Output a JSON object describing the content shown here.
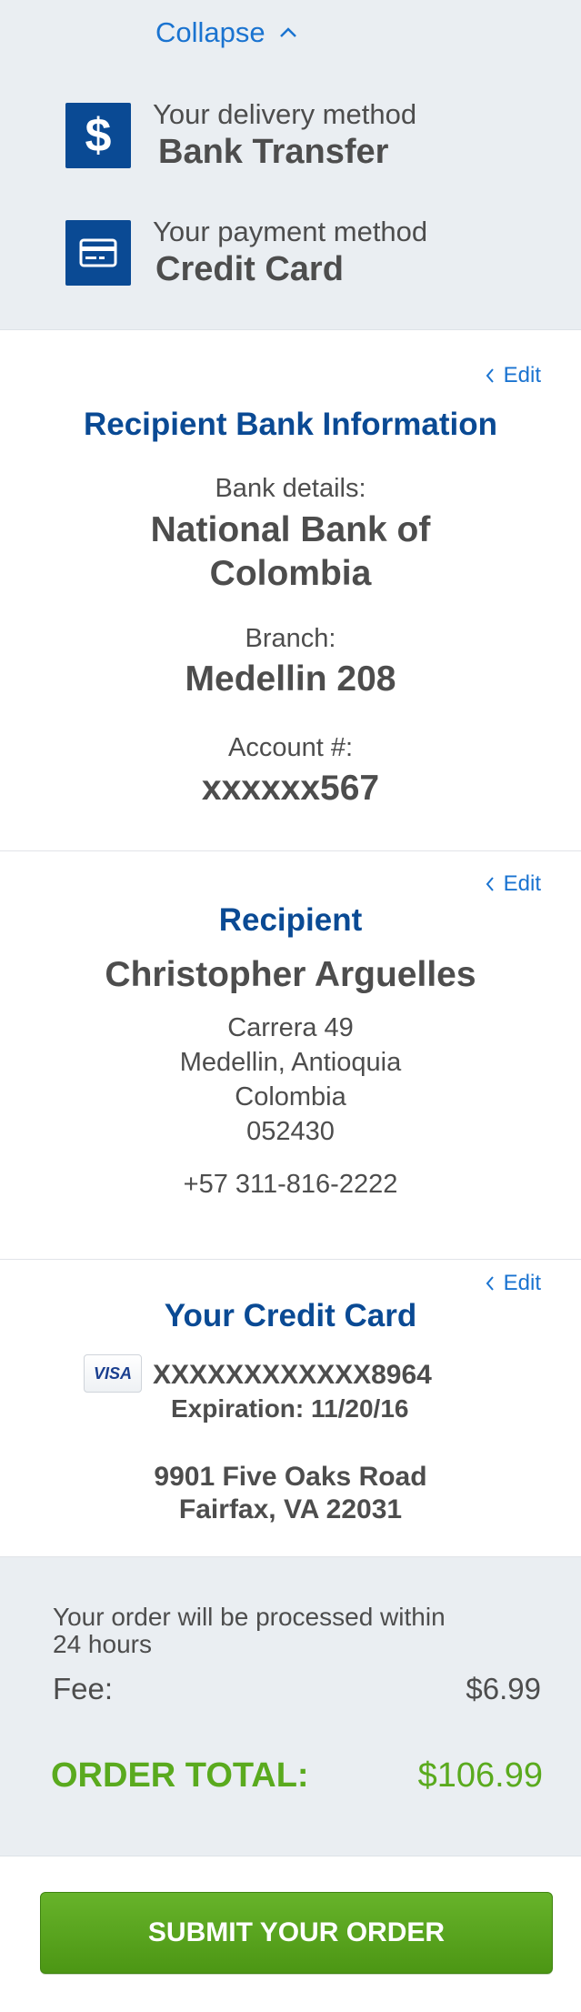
{
  "summary": {
    "collapse_label": "Collapse",
    "delivery": {
      "label": "Your delivery method",
      "value": "Bank Transfer",
      "icon": "dollar-icon"
    },
    "payment": {
      "label": "Your payment method",
      "value": "Credit Card",
      "icon": "credit-card-icon"
    }
  },
  "bank": {
    "edit_label": "Edit",
    "title": "Recipient Bank Information",
    "bank_details_label": "Bank details:",
    "bank_name_line1": "National Bank of",
    "bank_name_line2": "Colombia",
    "branch_label": "Branch:",
    "branch_value": "Medellin 208",
    "account_label": "Account #:",
    "account_value": "xxxxxx567"
  },
  "recipient": {
    "edit_label": "Edit",
    "title": "Recipient",
    "name": "Christopher Arguelles",
    "address_line1": "Carrera 49",
    "address_line2": "Medellin, Antioquia",
    "address_line3": "Colombia",
    "address_line4": "052430",
    "phone": "+57 311-816-2222"
  },
  "card": {
    "edit_label": "Edit",
    "title": "Your Credit Card",
    "brand": "VISA",
    "number": "XXXXXXXXXXXX8964",
    "expiration": "Expiration: 11/20/16",
    "billing_line1": "9901 Five Oaks Road",
    "billing_line2": "Fairfax, VA 22031"
  },
  "order": {
    "processing_line1": "Your order will be processed within",
    "processing_line2": "24 hours",
    "fee_label": "Fee:",
    "fee_value": "$6.99",
    "total_label": "ORDER TOTAL:",
    "total_value": "$106.99"
  },
  "submit_label": "SUBMIT YOUR ORDER",
  "colors": {
    "brand_blue": "#0a4a94",
    "link_blue": "#1a73d0",
    "total_green": "#5aaa1e",
    "button_green": "#5aa520"
  }
}
